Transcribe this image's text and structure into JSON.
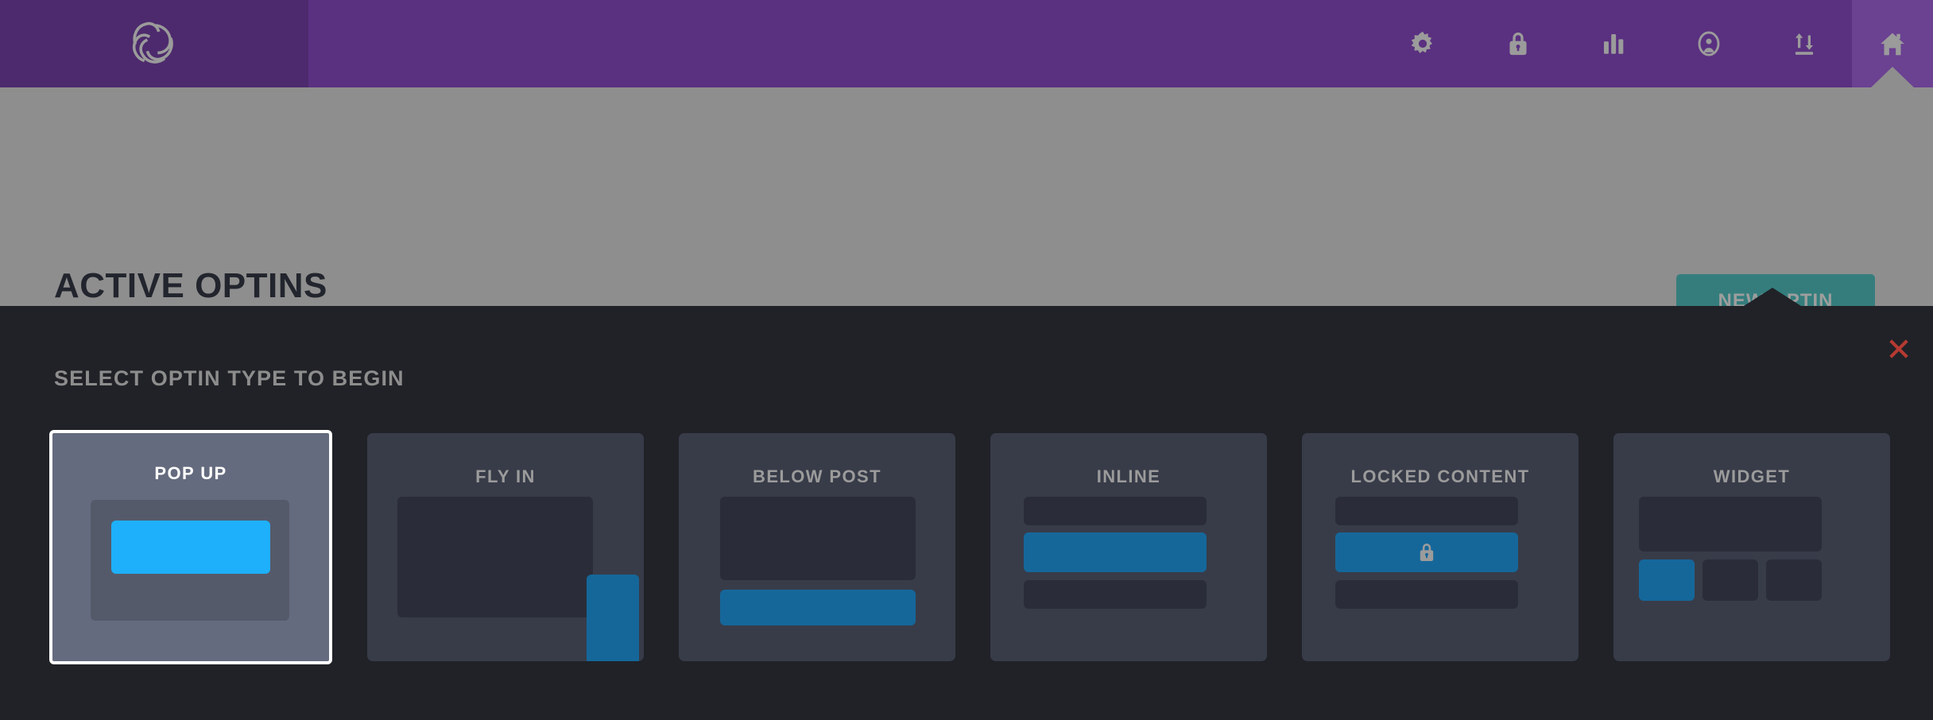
{
  "header": {
    "logo_icon": "rosette-logo",
    "nav": [
      {
        "icon": "gear-icon",
        "label": "Settings",
        "active": false
      },
      {
        "icon": "lock-icon",
        "label": "Locked",
        "active": false
      },
      {
        "icon": "bar-chart-icon",
        "label": "Statistics",
        "active": false
      },
      {
        "icon": "account-icon",
        "label": "Account",
        "active": false
      },
      {
        "icon": "import-export-icon",
        "label": "Import/Export",
        "active": false
      },
      {
        "icon": "home-icon",
        "label": "Home",
        "active": true
      }
    ]
  },
  "subheader": {
    "title": "ACTIVE OPTINS",
    "new_optin_label": "NEW OPTIN"
  },
  "panel": {
    "heading": "SELECT OPTIN TYPE TO BEGIN",
    "close_icon": "close-x-icon",
    "cards": [
      {
        "label": "POP UP",
        "selected": true
      },
      {
        "label": "FLY IN",
        "selected": false
      },
      {
        "label": "BELOW POST",
        "selected": false
      },
      {
        "label": "INLINE",
        "selected": false
      },
      {
        "label": "LOCKED CONTENT",
        "selected": false,
        "badge_icon": "lock-icon"
      },
      {
        "label": "WIDGET",
        "selected": false
      }
    ]
  },
  "colors": {
    "header_purple": "#5a3080",
    "logo_purple": "#4d2a6d",
    "active_tab_purple": "#6b4192",
    "overlay_grey": "#8e8e8e",
    "panel_dark": "#202227",
    "card_dark": "#383c49",
    "card_selected": "#656b7e",
    "accent_teal": "#357d7d",
    "accent_blue": "#15679a",
    "accent_cyan": "#1eb0fa",
    "close_red": "#b53a32"
  }
}
